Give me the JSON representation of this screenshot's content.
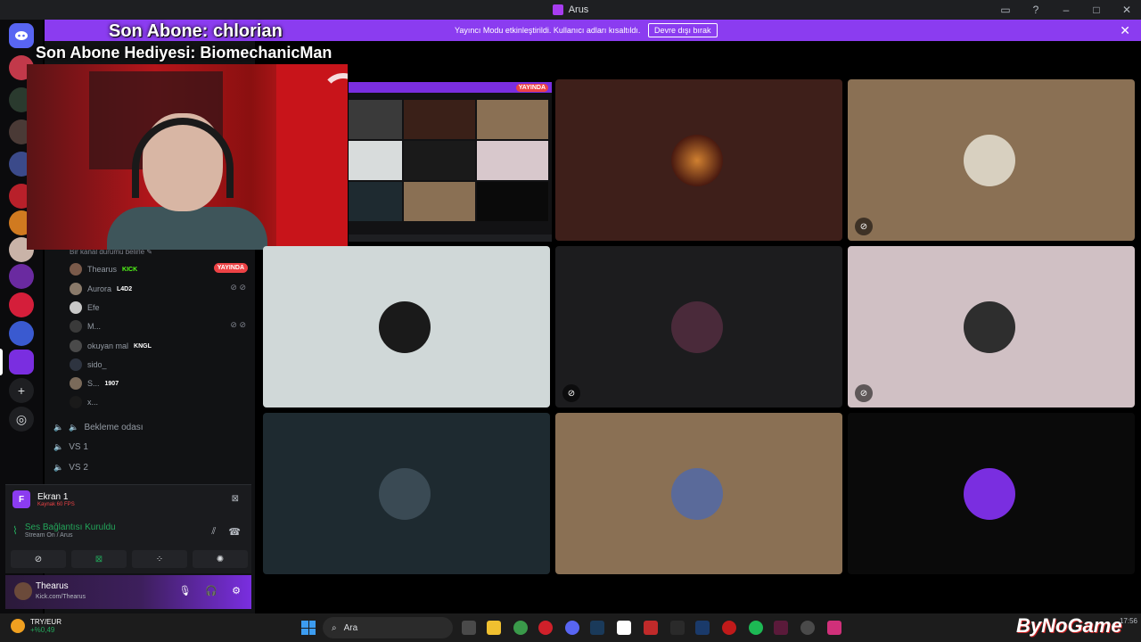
{
  "window": {
    "title": "Arus"
  },
  "streamer_banner": {
    "text": "Yayıncı Modu etkinleştirildi. Kullanıcı adları kısaltıldı.",
    "button": "Devre dışı bırak"
  },
  "overlay": {
    "last_sub": "Son Abone: chlorian",
    "last_gift": "Son Abone Hediyesi: BiomechanicMan"
  },
  "sidebar": {
    "status_hint": "Bir kanal durumu belirle",
    "voice_users": [
      {
        "name": "Thearus",
        "tag": "KICK",
        "live": "YAYINDA"
      },
      {
        "name": "Aurora",
        "tag": "L4D2"
      },
      {
        "name": "Efe",
        "tag": ""
      },
      {
        "name": "M...",
        "tag": ""
      },
      {
        "name": "okuyan mal",
        "tag": "KNGL"
      },
      {
        "name": "sido_",
        "tag": ""
      },
      {
        "name": "S...",
        "tag": "1907"
      },
      {
        "name": "x...",
        "tag": ""
      }
    ],
    "channels": [
      {
        "name": "Bekleme odası"
      },
      {
        "name": "VS 1"
      },
      {
        "name": "VS 2"
      }
    ]
  },
  "stream_panel": {
    "icon_letter": "F",
    "title": "Ekran 1",
    "subtitle": "Kaynak 60 FPS",
    "voice_title": "Ses Bağlantısı Kuruldu",
    "voice_sub": "Stream On / Arus"
  },
  "user_panel": {
    "name": "Thearus",
    "status": "Kick.com/Thearus"
  },
  "screenshare": {
    "live_label": "YAYINDA"
  },
  "taskbar": {
    "weather_title": "TRY/EUR",
    "weather_value": "+%0,49",
    "search_placeholder": "Ara",
    "clock": "17:56"
  },
  "watermark": "ByNoGame",
  "colors": {
    "accent": "#8b3cf0",
    "live_red": "#ed4245",
    "voice_green": "#23a55a"
  }
}
